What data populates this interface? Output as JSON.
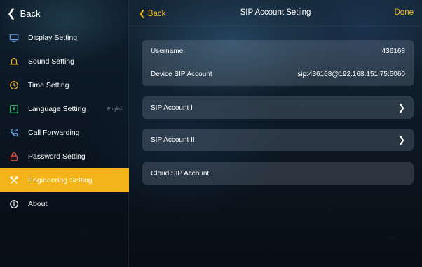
{
  "sidebar": {
    "back_label": "Back",
    "items": [
      {
        "label": "Display Setting",
        "icon": "monitor-icon"
      },
      {
        "label": "Sound Setting",
        "icon": "bell-icon"
      },
      {
        "label": "Time Setting",
        "icon": "clock-icon"
      },
      {
        "label": "Language Setting",
        "icon": "language-icon",
        "extra": "English"
      },
      {
        "label": "Call Forwarding",
        "icon": "call-forward-icon"
      },
      {
        "label": "Password Setting",
        "icon": "lock-icon"
      },
      {
        "label": "Engineering Setting",
        "icon": "tools-icon",
        "active": true
      },
      {
        "label": "About",
        "icon": "info-icon"
      }
    ]
  },
  "topbar": {
    "back_label": "Back",
    "title": "SIP Account Setiing",
    "done_label": "Done"
  },
  "account": {
    "username_label": "Username",
    "username_value": "436168",
    "device_sip_label": "Device SIP Account",
    "device_sip_value": "sip:436168@192.168.151.75:5060"
  },
  "menu": {
    "sip_account_1": "SIP Account I",
    "sip_account_2": "SIP Account II",
    "cloud_sip_account": "Cloud SIP Account"
  },
  "colors": {
    "accent": "#f3b41a",
    "icon_monitor": "#6aa3e8",
    "icon_bell": "#f3b41a",
    "icon_clock": "#f3b41a",
    "icon_language": "#3fbf6f",
    "icon_call": "#6aa3e8",
    "icon_lock": "#e5533d",
    "icon_info": "#ffffff"
  }
}
